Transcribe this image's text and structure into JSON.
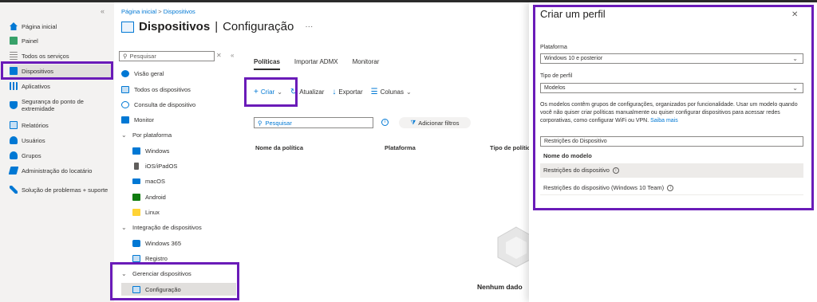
{
  "left_nav": {
    "items": [
      {
        "label": "Página inicial",
        "icon": "home-icon",
        "color": "#0078d4"
      },
      {
        "label": "Painel",
        "icon": "dashboard-icon",
        "color": "#38a169"
      },
      {
        "label": "Todos os serviços",
        "icon": "list-icon",
        "color": "#8a8886"
      },
      {
        "label": "Dispositivos",
        "icon": "devices-icon",
        "color": "#0078d4"
      },
      {
        "label": "Aplicativos",
        "icon": "apps-icon",
        "color": "#0078d4"
      },
      {
        "label": "Segurança do ponto de extremidade",
        "icon": "shield-icon",
        "color": "#0078d4"
      },
      {
        "label": "Relatórios",
        "icon": "reports-icon",
        "color": "#0078d4"
      },
      {
        "label": "Usuários",
        "icon": "user-icon",
        "color": "#0078d4"
      },
      {
        "label": "Grupos",
        "icon": "groups-icon",
        "color": "#0078d4"
      },
      {
        "label": "Administração do locatário",
        "icon": "tenant-admin-icon",
        "color": "#0078d4"
      },
      {
        "label": "Solução de problemas + suporte",
        "icon": "troubleshoot-icon",
        "color": "#0078d4"
      }
    ]
  },
  "breadcrumb": {
    "home": "Página inicial",
    "sep": ">",
    "current": "Dispositivos"
  },
  "title": {
    "main": "Dispositivos",
    "sep": "|",
    "sub": "Configuração",
    "more": "···"
  },
  "menu": {
    "search_placeholder": "Pesquisar",
    "items": [
      {
        "label": "Visão geral",
        "icon": "info-icon"
      },
      {
        "label": "Todos os dispositivos",
        "icon": "devices-icon"
      },
      {
        "label": "Consulta de dispositivo",
        "icon": "query-icon"
      },
      {
        "label": "Monitor",
        "icon": "monitor-icon"
      },
      {
        "label": "Por plataforma",
        "icon": "chevron-down-icon"
      },
      {
        "label": "Windows",
        "icon": "windows-icon"
      },
      {
        "label": "iOS/iPadOS",
        "icon": "ios-icon"
      },
      {
        "label": "macOS",
        "icon": "macos-icon"
      },
      {
        "label": "Android",
        "icon": "android-icon"
      },
      {
        "label": "Linux",
        "icon": "linux-icon"
      },
      {
        "label": "Integração de dispositivos",
        "icon": "chevron-down-icon"
      },
      {
        "label": "Windows 365",
        "icon": "windows365-icon"
      },
      {
        "label": "Registro",
        "icon": "enrollment-icon"
      },
      {
        "label": "Gerenciar dispositivos",
        "icon": "chevron-down-icon"
      },
      {
        "label": "Configuração",
        "icon": "configuration-icon"
      }
    ]
  },
  "tabs": [
    "Políticas",
    "Importar ADMX",
    "Monitorar"
  ],
  "toolbar": {
    "create": "Criar",
    "refresh": "Atualizar",
    "export": "Exportar",
    "columns": "Colunas"
  },
  "filter": {
    "search_placeholder": "Pesquisar",
    "add_filters": "Adicionar filtros"
  },
  "columns": [
    "Nome da política",
    "Plataforma",
    "Tipo de polític"
  ],
  "empty_text": "Nenhum dado",
  "panel": {
    "title": "Criar um perfil",
    "platform_label": "Plataforma",
    "platform_value": "Windows 10 e posterior",
    "profile_type_label": "Tipo de perfil",
    "profile_type_value": "Modelos",
    "description": "Os modelos contêm grupos de configurações, organizados por funcionalidade. Usar um modelo quando você não quiser criar políticas manualmente ou quiser configurar dispositivos para acessar redes corporativas, como configurar WiFi ou VPN.",
    "learn_more": "Saiba mais",
    "template_search_value": "Restrições do Dispositivo",
    "template_column": "Nome do modelo",
    "templates": [
      "Restrições do dispositivo",
      "Restrições do dispositivo (Windows 10 Team)"
    ]
  },
  "highlight_color": "#6a1bb8"
}
